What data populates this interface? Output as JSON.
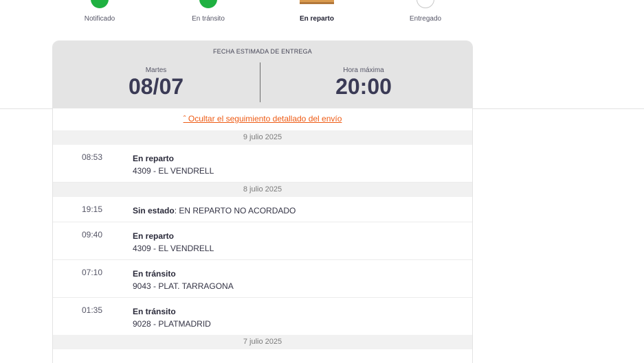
{
  "steps": [
    {
      "label": "Notificado",
      "state": "done"
    },
    {
      "label": "En tránsito",
      "state": "done"
    },
    {
      "label": "En reparto",
      "state": "current",
      "icon": "package-box-icon"
    },
    {
      "label": "Entregado",
      "state": "pending"
    }
  ],
  "estimate": {
    "title": "FECHA ESTIMADA DE ENTREGA",
    "day_label": "Martes",
    "date": "08/07",
    "hour_label": "Hora máxima",
    "hour": "20:00"
  },
  "toggle": {
    "arrow": "ˆ",
    "label": "Ocultar el seguimiento detallado del envío"
  },
  "timeline": [
    {
      "date": "9 julio 2025",
      "events": [
        {
          "time": "08:53",
          "status": "En reparto",
          "detail": "4309 - EL VENDRELL"
        }
      ]
    },
    {
      "date": "8 julio 2025",
      "events": [
        {
          "time": "19:15",
          "status": "Sin estado",
          "inline": ": EN REPARTO NO ACORDADO"
        },
        {
          "time": "09:40",
          "status": "En reparto",
          "detail": "4309 - EL VENDRELL"
        },
        {
          "time": "07:10",
          "status": "En tránsito",
          "detail": "9043 - PLAT. TARRAGONA"
        },
        {
          "time": "01:35",
          "status": "En tránsito",
          "detail": "9028 - PLATMADRID"
        }
      ]
    },
    {
      "date": "7 julio 2025",
      "events": []
    }
  ],
  "colors": {
    "done": "#1fb141",
    "accent_link": "#ee5a13",
    "header_bg": "#e4e4e4",
    "date_bar_bg": "#f1f1f1",
    "big_text": "#3a3a55",
    "box": "#d99a4e"
  }
}
